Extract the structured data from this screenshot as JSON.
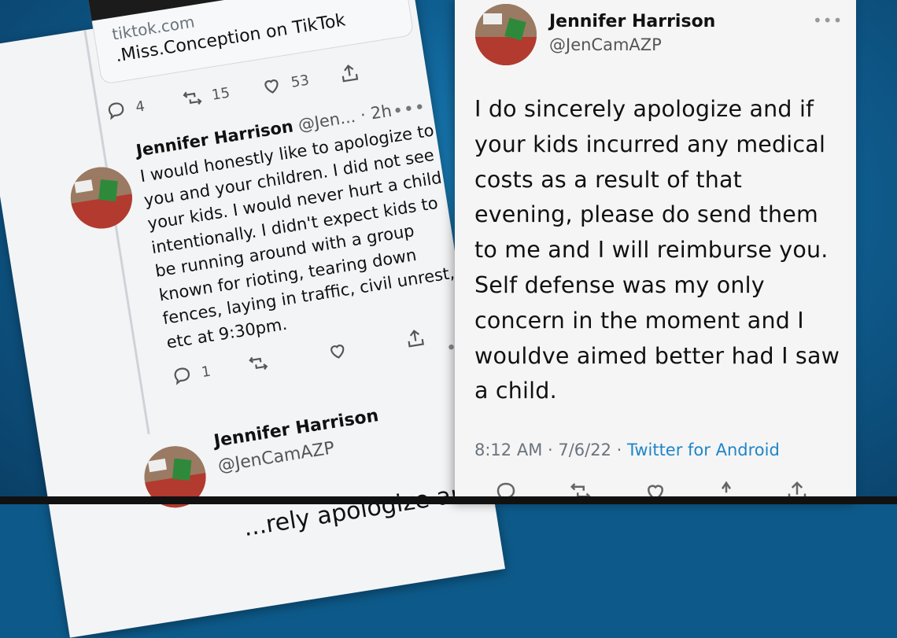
{
  "left_card": {
    "link_preview": {
      "domain": "tiktok.com",
      "title": ".Miss.Conception on TikTok"
    },
    "top_actions": {
      "replies": "4",
      "retweets": "15",
      "likes": "53"
    },
    "reply": {
      "name": "Jennifer Harrison",
      "handle_time": "@Jen... · 2h",
      "text": "I would honestly like to apologize to you and your children. I did not see your kids. I would never hurt a child intentionally. I didn't expect kids to be running around with a group known for rioting, tearing down fences, laying in traffic, civil unrest, etc at 9:30pm.",
      "replies": "1"
    },
    "next_tweet": {
      "name": "Jennifer Harrison",
      "handle": "@JenCamAZP",
      "partial_text": "...rely apologize and if"
    }
  },
  "right_card": {
    "name": "Jennifer Harrison",
    "handle": "@JenCamAZP",
    "text": "I do sincerely apologize and if your kids incurred any medical costs as a result of that evening, please do send them to me and I will reimburse you. Self defense was my only concern in the moment and I wouldve aimed better had I saw a child.",
    "time": "8:12 AM · 7/6/22 · ",
    "source": "Twitter for Android"
  },
  "colors": {
    "background": "#0f5f92",
    "link_blue": "#1d86c9",
    "card": "#f5f5f5"
  }
}
